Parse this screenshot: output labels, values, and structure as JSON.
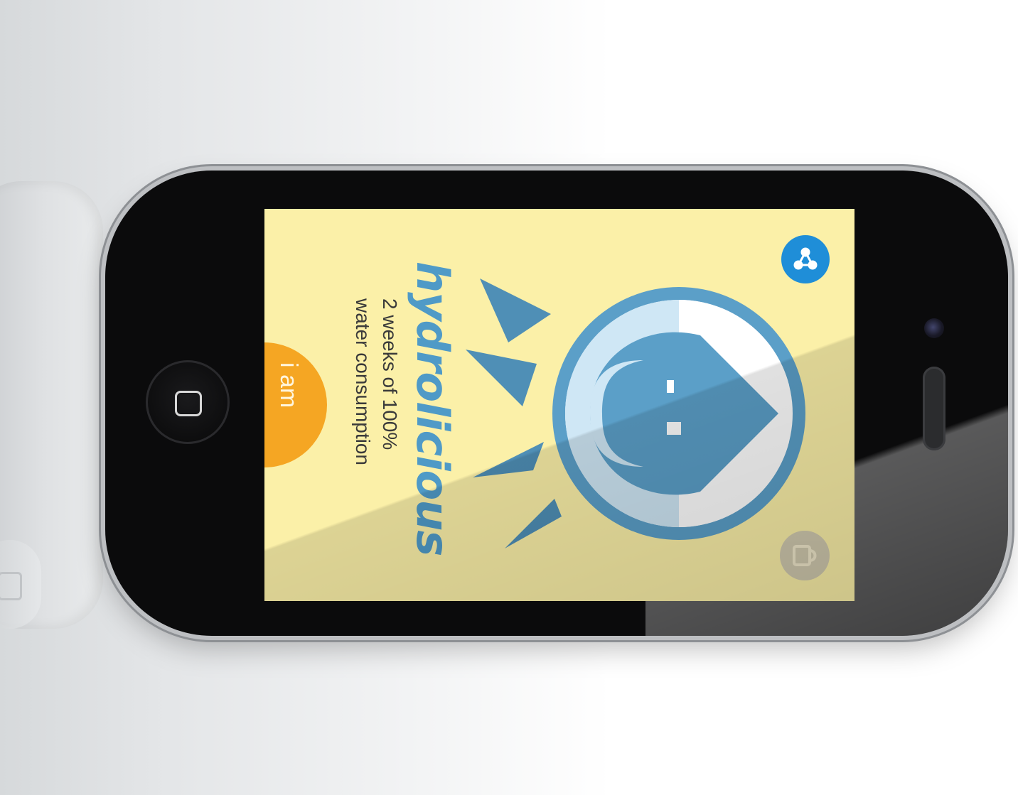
{
  "app": {
    "title": "hydrolicious",
    "subtitle_line1": "2 weeks of 100%",
    "subtitle_line2": "water consumption",
    "action_label": "i am"
  },
  "colors": {
    "screen_background": "#fbf0a8",
    "accent_blue": "#4f9ac7",
    "share_button": "#1f8ed8",
    "action_button": "#f5a623"
  },
  "icons": {
    "share": "share-icon",
    "cup": "cup-icon",
    "home": "home-button-icon",
    "character": "water-drop-character"
  }
}
